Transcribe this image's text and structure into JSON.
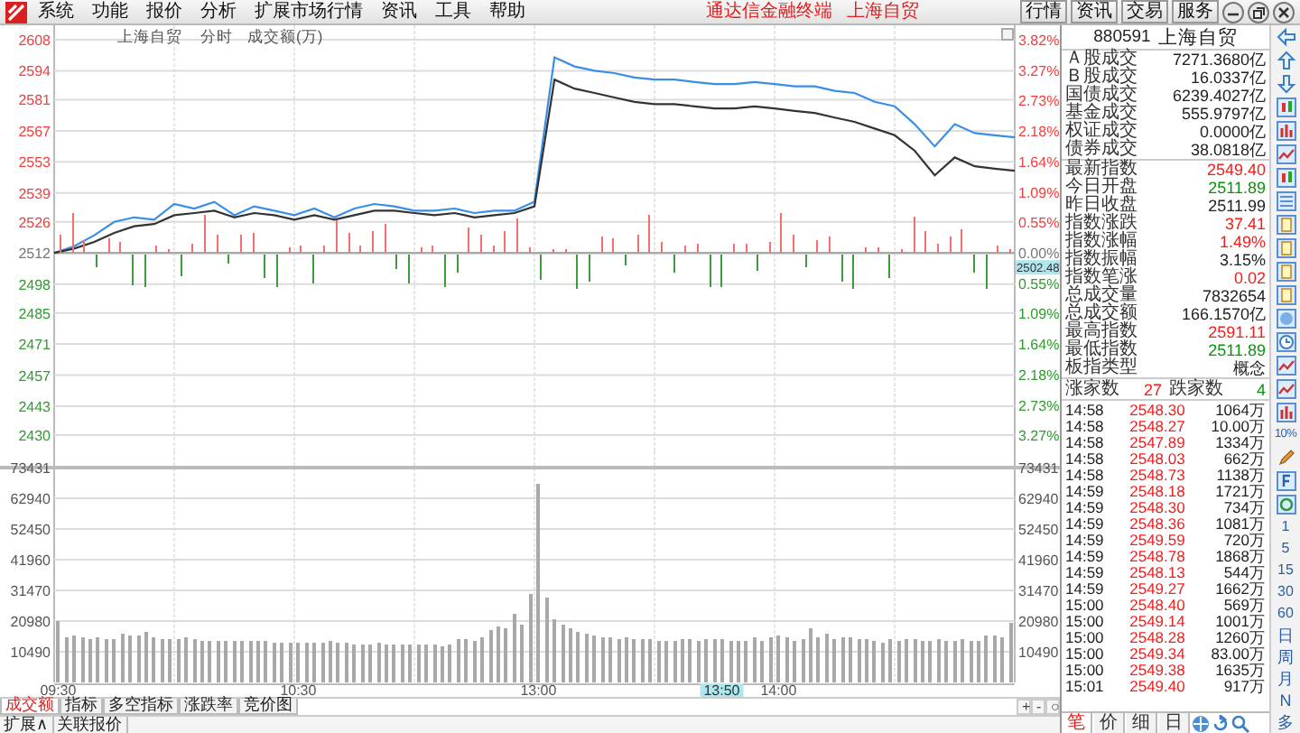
{
  "menu": [
    "系统",
    "功能",
    "报价",
    "分析",
    "扩展市场行情",
    "资讯",
    "工具",
    "帮助"
  ],
  "title_bar": {
    "app": "通达信金融终端",
    "security": "上海自贸"
  },
  "top_buttons": [
    "行情",
    "资讯",
    "交易",
    "服务"
  ],
  "chart": {
    "header": [
      "上海自贸",
      "分时",
      "成交额(万)"
    ],
    "cursor": {
      "price": "2502.48",
      "time": "13:50"
    },
    "price_chart": {
      "chart_data": {
        "type": "line",
        "grid": true,
        "ylim": [
          2430,
          2608
        ],
        "y2lim": [
          -3.27,
          3.82
        ],
        "yticks": [
          2608,
          2594,
          2581,
          2567,
          2553,
          2539,
          2526,
          2512,
          2498,
          2485,
          2471,
          2457,
          2443,
          2430
        ],
        "y2ticks": [
          {
            "value": 3.82,
            "label": "3.82%"
          },
          {
            "value": 3.27,
            "label": "3.27%"
          },
          {
            "value": 2.73,
            "label": "2.73%"
          },
          {
            "value": 2.18,
            "label": "2.18%"
          },
          {
            "value": 1.64,
            "label": "1.64%"
          },
          {
            "value": 1.09,
            "label": "1.09%"
          },
          {
            "value": 0.55,
            "label": "0.55%"
          },
          {
            "value": 0,
            "label": "0.00%"
          },
          {
            "value": -0.55,
            "label": "0.55%"
          },
          {
            "value": -1.09,
            "label": "1.09%"
          },
          {
            "value": -1.64,
            "label": "1.64%"
          },
          {
            "value": -2.18,
            "label": "2.18%"
          },
          {
            "value": -2.73,
            "label": "2.73%"
          },
          {
            "value": -3.27,
            "label": "3.27%"
          }
        ],
        "series": [
          {
            "color": "#3a8ee6",
            "values": [
              2512,
              2515,
              2520,
              2526,
              2528,
              2527,
              2534,
              2532,
              2535,
              2529,
              2533,
              2531,
              2529,
              2532,
              2528,
              2532,
              2534,
              2533,
              2531,
              2531,
              2532,
              2530,
              2531,
              2531,
              2535,
              2600,
              2596,
              2594,
              2593,
              2591,
              2590,
              2590,
              2589,
              2588,
              2588,
              2589,
              2588,
              2587,
              2587,
              2585,
              2584,
              2580,
              2578,
              2570,
              2560,
              2570,
              2566,
              2565,
              2564
            ]
          },
          {
            "color": "#333333",
            "values": [
              2512,
              2514,
              2517,
              2521,
              2524,
              2525,
              2529,
              2530,
              2531,
              2528,
              2530,
              2529,
              2527,
              2529,
              2527,
              2529,
              2531,
              2531,
              2530,
              2529,
              2530,
              2528,
              2529,
              2530,
              2533,
              2590,
              2586,
              2584,
              2582,
              2580,
              2579,
              2579,
              2578,
              2577,
              2577,
              2578,
              2577,
              2576,
              2575,
              2573,
              2571,
              2568,
              2565,
              2558,
              2547,
              2555,
              2551,
              2550,
              2549
            ]
          }
        ]
      }
    },
    "volume_chart": {
      "chart_data": {
        "type": "bar",
        "grid": true,
        "ylim": [
          0,
          73431
        ],
        "y2lim": [
          0,
          73431
        ],
        "yticks": [
          73431,
          62940,
          52450,
          41960,
          31470,
          20980,
          10490
        ],
        "y2ticks": [
          73431,
          62940,
          52450,
          41960,
          31470,
          20980,
          10490
        ],
        "categories": [
          "09:30",
          null,
          null,
          null,
          null,
          null,
          null,
          null,
          null,
          null,
          null,
          null,
          null,
          null,
          null,
          null,
          null,
          null,
          null,
          null,
          null,
          null,
          null,
          null,
          null,
          null,
          null,
          null,
          null,
          null,
          "10:30",
          null,
          null,
          null,
          null,
          null,
          null,
          null,
          null,
          null,
          null,
          null,
          null,
          null,
          null,
          null,
          null,
          null,
          null,
          null,
          null,
          null,
          null,
          null,
          null,
          null,
          null,
          null,
          null,
          null,
          "13:00",
          null,
          null,
          null,
          null,
          null,
          null,
          null,
          null,
          null,
          null,
          null,
          null,
          null,
          null,
          null,
          null,
          null,
          null,
          null,
          null,
          null,
          null,
          null,
          null,
          null,
          null,
          null,
          null,
          null,
          "14:00",
          null,
          null,
          null,
          null,
          null,
          null,
          null,
          null,
          null,
          null,
          null,
          null,
          null,
          null,
          null,
          null,
          null,
          null,
          null,
          null,
          null,
          null,
          null,
          null,
          null,
          null,
          null,
          null,
          null
        ],
        "values": [
          20900,
          15600,
          16000,
          15700,
          14900,
          15300,
          15100,
          15000,
          16700,
          16300,
          16200,
          17000,
          15300,
          15100,
          14900,
          14800,
          15200,
          14600,
          14100,
          14300,
          14200,
          14100,
          14400,
          14200,
          14100,
          13900,
          13900,
          13600,
          13500,
          13700,
          13600,
          13800,
          13500,
          13400,
          13900,
          13500,
          13300,
          13200,
          13200,
          13100,
          13400,
          13000,
          13200,
          12900,
          12800,
          12900,
          12700,
          12700,
          12600,
          12800,
          14600,
          14900,
          14200,
          15600,
          17700,
          19100,
          18400,
          23300,
          19800,
          30000,
          68000,
          29000,
          21900,
          19800,
          18400,
          17400,
          16700,
          16300,
          15600,
          15300,
          14900,
          15300,
          14600,
          14900,
          14800,
          14300,
          13900,
          14200,
          14800,
          14600,
          14200,
          14600,
          14900,
          14600,
          14200,
          14100,
          14300,
          15300,
          14200,
          15600,
          16000,
          15500,
          14200,
          14900,
          18400,
          15600,
          16700,
          14800,
          15300,
          15300,
          15000,
          14600,
          14200,
          13500,
          14800,
          14300,
          14600,
          14900,
          14300,
          14200,
          14800,
          14200,
          13900,
          14600,
          14100,
          14200,
          16000,
          16300,
          15600,
          20500
        ]
      }
    }
  },
  "indicator_tabs": [
    {
      "label": "成交额",
      "selected": true
    },
    {
      "label": "指标",
      "selected": false
    },
    {
      "label": "多空指标",
      "selected": false
    },
    {
      "label": "涨跌率",
      "selected": false
    },
    {
      "label": "竞价图",
      "selected": false
    }
  ],
  "zoom_buttons": [
    "+",
    "-",
    "○"
  ],
  "bottom_tabs": [
    "扩展∧",
    "关联报价"
  ],
  "quote_panel": {
    "code": "880591",
    "name": "上海自贸",
    "turnover": [
      {
        "label": "Ａ股成交",
        "value": "7271.3680亿"
      },
      {
        "label": "Ｂ股成交",
        "value": "16.0337亿"
      },
      {
        "label": "国债成交",
        "value": "6239.4027亿"
      },
      {
        "label": "基金成交",
        "value": "555.9797亿"
      },
      {
        "label": "权证成交",
        "value": "0.0000亿"
      },
      {
        "label": "债券成交",
        "value": "38.0818亿"
      }
    ],
    "stats": [
      {
        "label": "最新指数",
        "value": "2549.40",
        "color": "#f02020"
      },
      {
        "label": "今日开盘",
        "value": "2511.89",
        "color": "#109010"
      },
      {
        "label": "昨日收盘",
        "value": "2511.99",
        "color": "#222222"
      },
      {
        "label": "指数涨跌",
        "value": "37.41",
        "color": "#f02020"
      },
      {
        "label": "指数涨幅",
        "value": "1.49%",
        "color": "#f02020"
      },
      {
        "label": "指数振幅",
        "value": "3.15%",
        "color": "#222222"
      },
      {
        "label": "指数笔涨",
        "value": "0.02",
        "color": "#f02020"
      },
      {
        "label": "总成交量",
        "value": "7832654",
        "color": "#222222"
      },
      {
        "label": "总成交额",
        "value": "166.1570亿",
        "color": "#222222"
      },
      {
        "label": "最高指数",
        "value": "2591.11",
        "color": "#f02020"
      },
      {
        "label": "最低指数",
        "value": "2511.89",
        "color": "#109010"
      },
      {
        "label": "板指类型",
        "value": "概念",
        "color": "#222222"
      }
    ],
    "breadth": {
      "up_label": "涨家数",
      "up_count": "27",
      "down_label": "跌家数",
      "down_count": "4"
    },
    "ticks": [
      {
        "time": "14:58",
        "price": "2548.30",
        "volume": "1064万"
      },
      {
        "time": "14:58",
        "price": "2548.27",
        "volume": "10.00万"
      },
      {
        "time": "14:58",
        "price": "2547.89",
        "volume": "1334万"
      },
      {
        "time": "14:58",
        "price": "2548.03",
        "volume": "662万"
      },
      {
        "time": "14:58",
        "price": "2548.73",
        "volume": "1138万"
      },
      {
        "time": "14:59",
        "price": "2548.18",
        "volume": "1721万"
      },
      {
        "time": "14:59",
        "price": "2548.30",
        "volume": "734万"
      },
      {
        "time": "14:59",
        "price": "2548.36",
        "volume": "1081万"
      },
      {
        "time": "14:59",
        "price": "2549.59",
        "volume": "720万"
      },
      {
        "time": "14:59",
        "price": "2548.78",
        "volume": "1868万"
      },
      {
        "time": "14:59",
        "price": "2548.13",
        "volume": "544万"
      },
      {
        "time": "14:59",
        "price": "2549.27",
        "volume": "1662万"
      },
      {
        "time": "15:00",
        "price": "2548.40",
        "volume": "569万"
      },
      {
        "time": "15:00",
        "price": "2549.14",
        "volume": "1001万"
      },
      {
        "time": "15:00",
        "price": "2548.28",
        "volume": "1260万"
      },
      {
        "time": "15:00",
        "price": "2549.34",
        "volume": "83.00万"
      },
      {
        "time": "15:00",
        "price": "2549.38",
        "volume": "1635万"
      },
      {
        "time": "15:01",
        "price": "2549.40",
        "volume": "917万"
      }
    ],
    "tabs": [
      {
        "label": "笔",
        "selected": true
      },
      {
        "label": "价",
        "selected": false
      },
      {
        "label": "细",
        "selected": false
      },
      {
        "label": "日",
        "selected": false
      }
    ]
  },
  "toolbar": {
    "percent": "10%",
    "periods": [
      "1",
      "5",
      "15",
      "30",
      "60",
      "日",
      "周",
      "月",
      "N",
      "多"
    ]
  }
}
